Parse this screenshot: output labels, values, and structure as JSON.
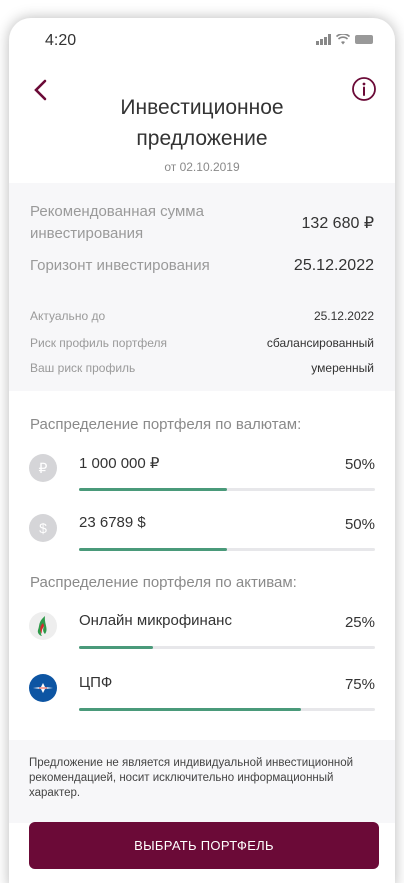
{
  "status": {
    "time": "4:20"
  },
  "header": {
    "title": "Инвестиционное предложение",
    "subtitle": "от 02.10.2019"
  },
  "summary": {
    "recommended_label": "Рекомендованная сумма инвестирования",
    "recommended_value": "132 680 ₽",
    "horizon_label": "Горизонт инвестирования",
    "horizon_value": "25.12.2022",
    "valid_label": "Актуально до",
    "valid_value": "25.12.2022",
    "portfolio_risk_label": "Риск профиль портфеля",
    "portfolio_risk_value": "сбалансированный",
    "your_risk_label": "Ваш риск профиль",
    "your_risk_value": "умеренный"
  },
  "currencies": {
    "title": "Распределение портфеля по валютам:",
    "items": [
      {
        "symbol": "₽",
        "label": "1 000 000 ₽",
        "percent": "50%",
        "share": 0.5,
        "icon": "ruble-icon"
      },
      {
        "symbol": "$",
        "label": "23 6789 $",
        "percent": "50%",
        "share": 0.5,
        "icon": "dollar-icon"
      }
    ]
  },
  "assets": {
    "title": "Распределение портфеля по активам:",
    "items": [
      {
        "label": "Онлайн микрофинанс",
        "percent": "25%",
        "share": 0.25,
        "icon": "flame-logo-icon"
      },
      {
        "label": "ЦПФ",
        "percent": "75%",
        "share": 0.75,
        "icon": "plane-logo-icon"
      }
    ]
  },
  "disclaimer": "Предложение не является индивидуальной инвестиционной рекомендацией, носит исключительно информационный характер.",
  "cta": "ВЫБРАТЬ ПОРТФЕЛЬ",
  "colors": {
    "accent": "#6b0a37",
    "progress": "#4a9a7a"
  }
}
